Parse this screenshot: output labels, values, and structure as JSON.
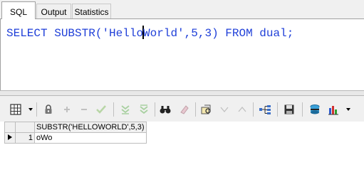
{
  "tabs": [
    {
      "label": "SQL",
      "active": true
    },
    {
      "label": "Output",
      "active": false
    },
    {
      "label": "Statistics",
      "active": false
    }
  ],
  "editor": {
    "kw_select": "SELECT",
    "fn_substr": "SUBSTR",
    "lparen": "(",
    "str_before_caret": "'Hello",
    "str_after_caret": "World'",
    "args": ",5,3)",
    "kw_from": "FROM",
    "table_name": "dual;",
    "color": "#1f3fd8"
  },
  "toolbar": {
    "icons": [
      "grid-menu-icon",
      "lock-icon",
      "add-record-icon",
      "delete-record-icon",
      "post-changes-icon",
      "first-record-icon",
      "last-record-icon",
      "find-icon",
      "clear-icon",
      "query-by-example-icon",
      "previous-icon",
      "next-icon",
      "tree-view-icon",
      "save-icon",
      "export-icon",
      "chart-icon"
    ]
  },
  "grid": {
    "column_header": "SUBSTR('HELLOWORLD',5,3)",
    "rows": [
      {
        "num": "1",
        "value": "oWo"
      }
    ]
  }
}
